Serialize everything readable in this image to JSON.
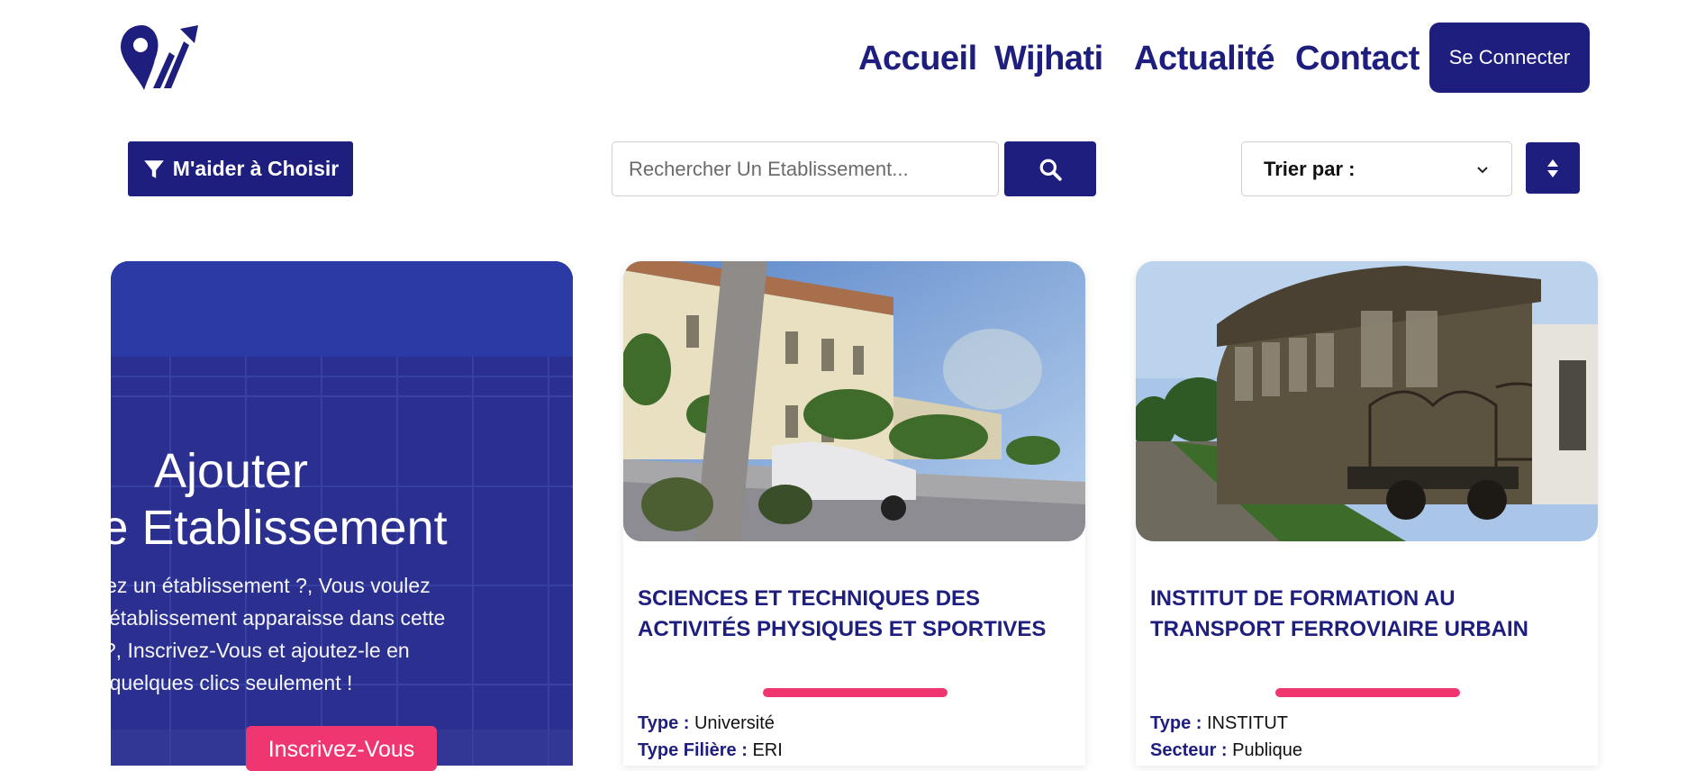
{
  "nav": {
    "items": [
      "Accueil",
      "Wijhati",
      "Actualité",
      "Contact"
    ],
    "connect_label": "Se Connecter"
  },
  "toolbar": {
    "filter_label": "M'aider à Choisir",
    "search_placeholder": "Rechercher Un Etablissement...",
    "sort_label": "Trier par :"
  },
  "promo": {
    "title_line1": "Ajouter",
    "title_line2": "Votre Etablissement",
    "text": "Vous avez un établissement ?, Vous voulez que votre établissement apparaisse dans cette page ?, Inscrivez-Vous et ajoutez-le en quelques clics seulement !",
    "button_label": "Inscrivez-Vous"
  },
  "cards": [
    {
      "title": "SCIENCES ET TECHNIQUES DES ACTIVITÉS PHYSIQUES ET SPORTIVES",
      "meta": [
        {
          "key": "Type :",
          "value": "Université"
        },
        {
          "key": "Type Filière :",
          "value": "ERI"
        }
      ]
    },
    {
      "title": "INSTITUT DE FORMATION AU TRANSPORT FERROVIAIRE URBAIN",
      "meta": [
        {
          "key": "Type :",
          "value": "INSTITUT"
        },
        {
          "key": "Secteur :",
          "value": "Publique"
        }
      ]
    }
  ],
  "colors": {
    "brand": "#1e1e7e",
    "accent": "#ef3671"
  }
}
